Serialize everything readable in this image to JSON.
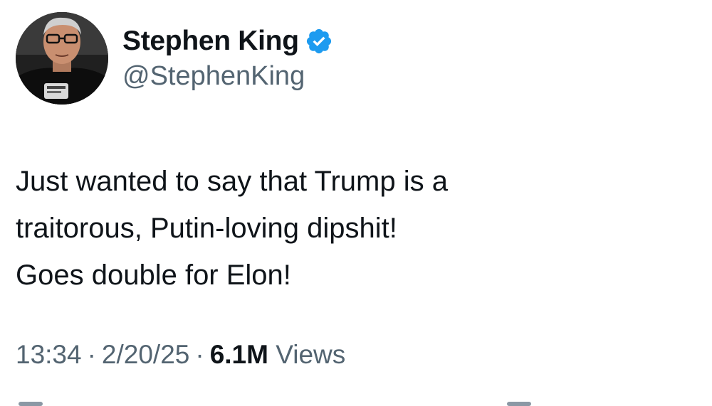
{
  "author": {
    "display_name": "Stephen King",
    "handle": "@StephenKing",
    "verified": true,
    "avatar_icon": "profile-photo",
    "verified_icon": "verified-badge-icon",
    "verified_color": "#1d9bf0"
  },
  "tweet": {
    "text_lines": [
      "Just wanted to say that Trump is a",
      "traitorous, Putin-loving dipshit!",
      "Goes double for Elon!"
    ]
  },
  "meta": {
    "time": "13:34",
    "separator": "·",
    "date": "2/20/25",
    "views_count": "6.1M",
    "views_label": "Views"
  },
  "colors": {
    "text_primary": "#0f1419",
    "text_secondary": "#536471",
    "background": "#ffffff"
  }
}
